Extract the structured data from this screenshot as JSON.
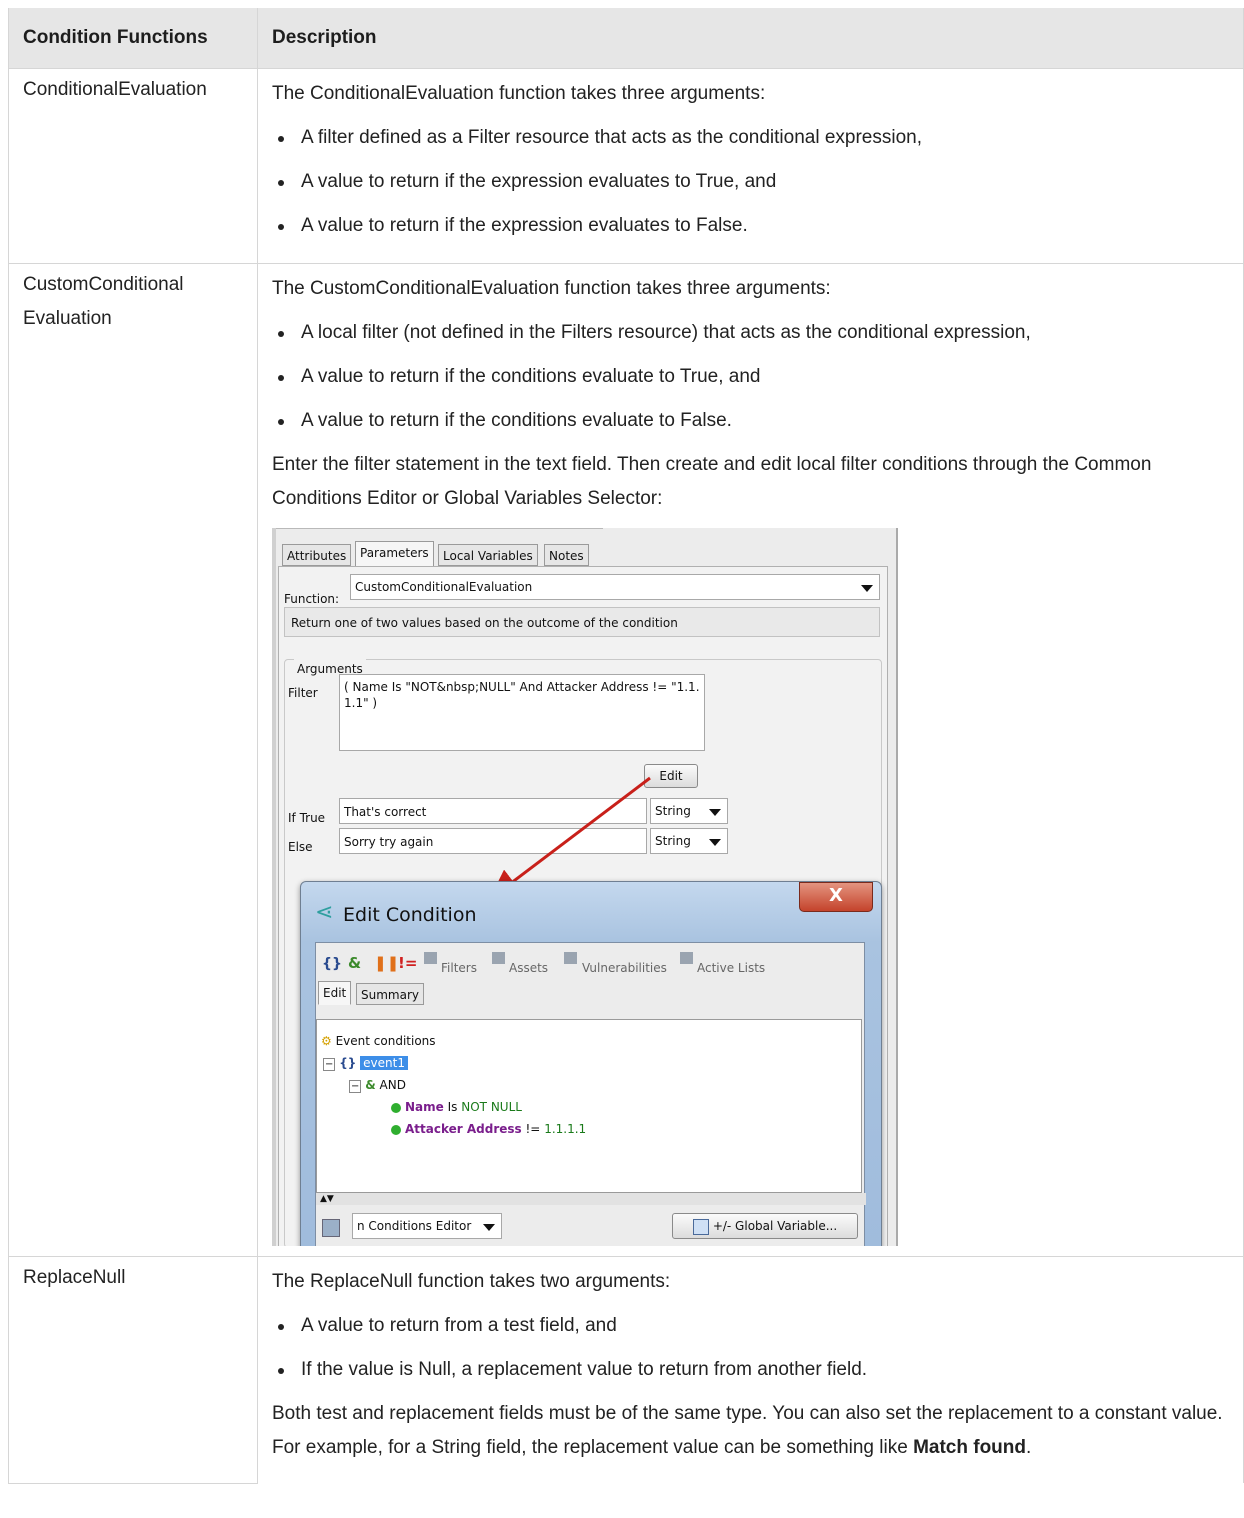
{
  "table": {
    "headers": [
      "Condition Functions",
      "Description"
    ],
    "rows": [
      {
        "function": "ConditionalEvaluation",
        "intro": "The ConditionalEvaluation function takes three arguments:",
        "bullets": [
          "A filter defined as a Filter resource that acts as the conditional expression,",
          "A value to return if the expression evaluates to True, and",
          "A value to return if the expression evaluates to False."
        ]
      },
      {
        "function_line1": "CustomConditional",
        "function_line2": "Evaluation",
        "intro": "The CustomConditionalEvaluation function takes three arguments:",
        "bullets": [
          "A local filter (not defined in the Filters resource) that acts as the conditional expression,",
          "A value to return if the conditions evaluate to True, and",
          "A value to return if the conditions evaluate to False."
        ],
        "after": "Enter the filter statement in the text field. Then create and edit local filter conditions through the Common Conditions Editor or Global Variables Selector:"
      },
      {
        "function": "ReplaceNull",
        "intro": "The ReplaceNull function takes two arguments:",
        "bullets": [
          "A value to return from a test field, and",
          "If the value is Null, a replacement value to return from another field."
        ],
        "after_prefix": "Both test and replacement fields must be of the same type. You can also set the replacement to a constant value. For example, for a String field, the replacement value can be something like ",
        "after_bold": "Match found",
        "after_suffix": "."
      }
    ]
  },
  "screenshot": {
    "tabs": [
      "Attributes",
      "Parameters",
      "Local Variables",
      "Notes"
    ],
    "function_label": "Function:",
    "function_value": "CustomConditionalEvaluation",
    "description": "Return one of two values based on the outcome of the condition",
    "arguments_label": "Arguments",
    "filter_label": "Filter",
    "filter_value": "( Name Is \"NOT&nbsp;NULL\" And Attacker Address != \"1.1.1.1\" )",
    "edit_button": "Edit",
    "if_true_label": "If True",
    "if_true_value": "That's correct",
    "else_label": "Else",
    "else_value": "Sorry try again",
    "type_option": "String",
    "dialog": {
      "title": "Edit Condition",
      "close": "X",
      "toolbar": [
        "Filters",
        "Assets",
        "Vulnerabilities",
        "Active Lists"
      ],
      "tabs": [
        "Edit",
        "Summary"
      ],
      "tree_root": "Event conditions",
      "event": "event1",
      "and_label": "AND",
      "cond1_field": "Name",
      "cond1_op": "Is",
      "cond1_value": "NOT NULL",
      "cond2_field": "Attacker Address",
      "cond2_op": "!=",
      "cond2_value": "1.1.1.1",
      "editor_select": "n Conditions Editor",
      "global_var_button": "+/- Global Variable..."
    }
  }
}
